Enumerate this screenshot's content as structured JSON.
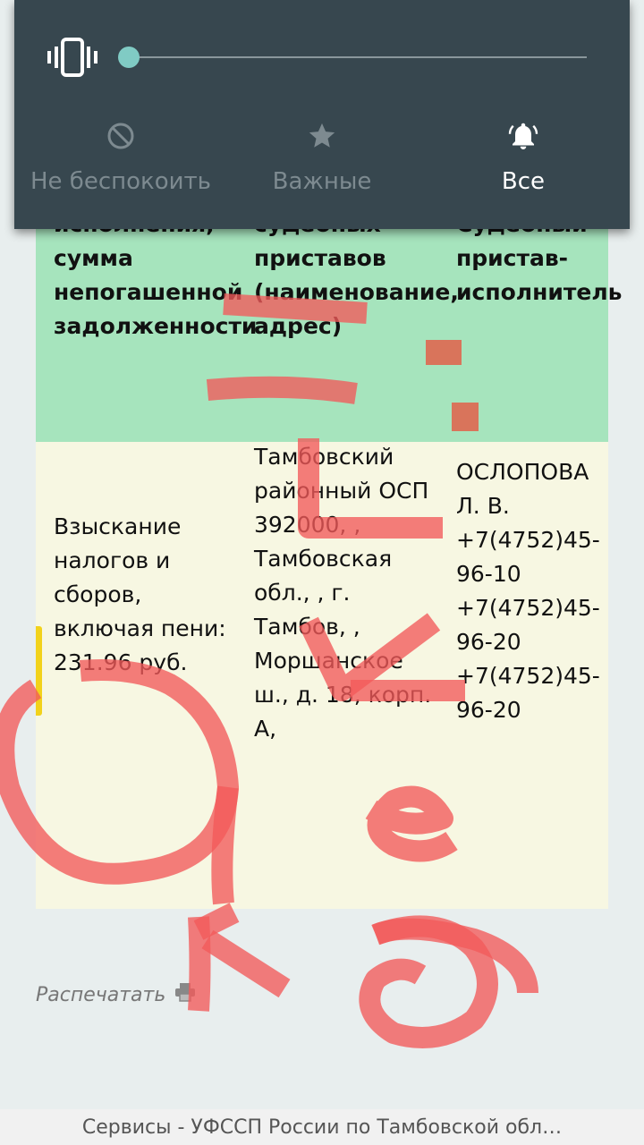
{
  "volume_panel": {
    "level": 0.0,
    "modes": [
      {
        "label": "Не беспокоить",
        "icon": "do-not-disturb-icon",
        "active": false
      },
      {
        "label": "Важные",
        "icon": "star-icon",
        "active": false
      },
      {
        "label": "Все",
        "icon": "bell-icon",
        "active": true
      }
    ]
  },
  "table": {
    "headers": [
      "исполнения, сумма непогашенной задолженности",
      "судебных приставов (наименование, адрес)",
      "Судебный пристав-исполнитель"
    ],
    "row": {
      "subject": "Взыскание налогов и сборов, включая пени: 231.96 руб.",
      "department": "Тамбовский районный ОСП 392000, , Тамбовская обл., , г. Тамбов, , Моршанское ш., д. 18, корп. А,",
      "officer": "ОСЛОПОВА Л. В. +7(4752)45-96-10 +7(4752)45-96-20 +7(4752)45-96-20"
    }
  },
  "print_label": "Распечатать",
  "url_bar": "Сервисы - УФССП России по Тамбовской обл…",
  "colors": {
    "panel_bg": "#37474f",
    "header_row": "#a6e4bd",
    "body_row": "#f7f7e2",
    "scribble": "#f25a5a",
    "slider_accent": "#80cbc4"
  }
}
